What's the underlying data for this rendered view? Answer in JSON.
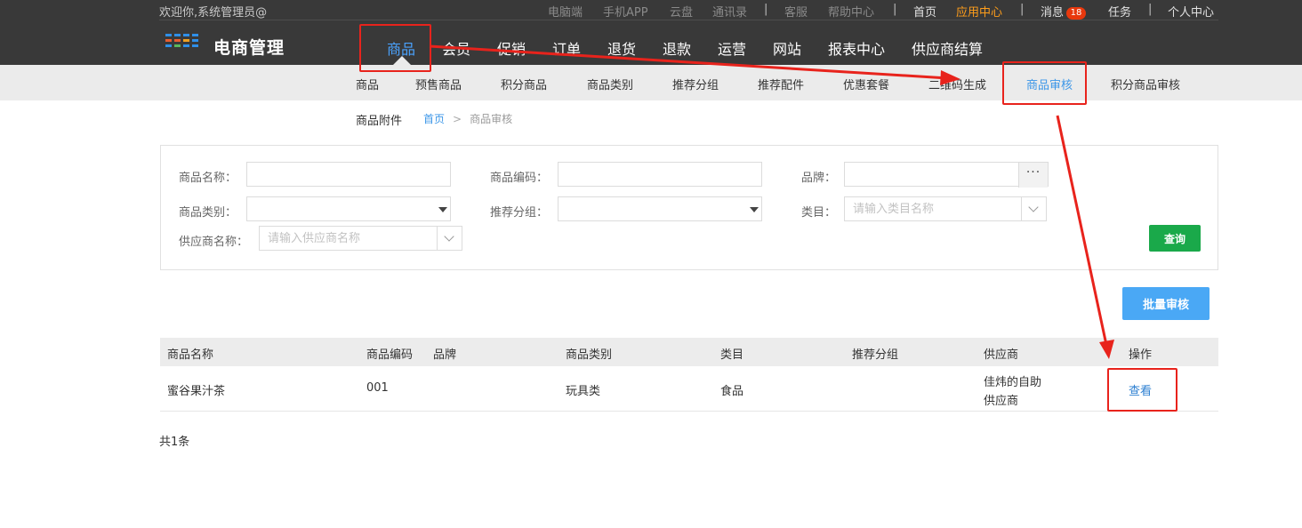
{
  "header": {
    "welcome": "欢迎你,系统管理员@",
    "toplinks": {
      "pc": "电脑端",
      "app": "手机APP",
      "cloud": "云盘",
      "contacts": "通讯录",
      "sep": "|",
      "service": "客服",
      "help": "帮助中心",
      "home": "首页",
      "app_center": "应用中心",
      "messages": "消息",
      "messages_count": "18",
      "tasks": "任务",
      "profile": "个人中心"
    },
    "brand": "电商管理",
    "main_nav": [
      "商品",
      "会员",
      "促销",
      "订单",
      "退货",
      "退款",
      "运营",
      "网站",
      "报表中心",
      "供应商结算"
    ],
    "active_main_nav": "商品"
  },
  "subnav": {
    "items": [
      "商品",
      "预售商品",
      "积分商品",
      "商品类别",
      "推荐分组",
      "推荐配件",
      "优惠套餐",
      "二维码生成",
      "商品审核",
      "积分商品审核"
    ],
    "active": "商品审核"
  },
  "breadcrumb": {
    "section": "商品附件",
    "home": "首页",
    "separator": ">",
    "current": "商品审核"
  },
  "filter": {
    "product_name_label": "商品名称：",
    "product_code_label": "商品编码：",
    "brand_label": "品牌：",
    "brand_button": "···",
    "category_label": "商品类别：",
    "group_label": "推荐分组：",
    "catalog_label": "类目：",
    "catalog_placeholder": "请输入类目名称",
    "supplier_label": "供应商名称：",
    "supplier_placeholder": "请输入供应商名称",
    "query_button": "查询"
  },
  "batch_button": "批量审核",
  "table": {
    "columns": [
      "商品名称",
      "商品编码",
      "品牌",
      "商品类别",
      "类目",
      "推荐分组",
      "供应商",
      "操作"
    ],
    "rows": [
      {
        "name": "蜜谷果汁茶",
        "code": "001",
        "brand": "",
        "category": "玩具类",
        "catalog": "食品",
        "group": "",
        "supplier_line1": "佳炜的自助",
        "supplier_line2": "供应商",
        "action": "查看"
      }
    ],
    "total": "共1条"
  },
  "colors": {
    "header_bg": "#393939",
    "subnav_bg": "#ebebeb",
    "accent_blue": "#3d97e8",
    "app_center_orange": "#ff9e1b",
    "query_green": "#1aa94a",
    "batch_blue": "#4aa8f5",
    "annotation_red": "#e8231c",
    "badge_red": "#e8380d"
  }
}
